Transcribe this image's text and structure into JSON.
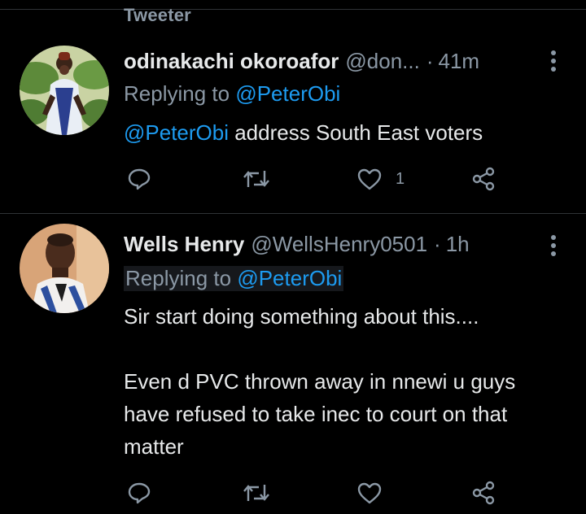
{
  "section_label": "Tweeter",
  "colors": {
    "background": "#000000",
    "text_primary": "#e7e9ea",
    "text_secondary": "#8b98a5",
    "link": "#1d9bf0",
    "divider": "#2f3336"
  },
  "tweets": [
    {
      "name": "odinakachi okoroafor",
      "handle": "@don...",
      "dot": "·",
      "time": "41m",
      "replying_prefix": "Replying to",
      "replying_handle": "@PeterObi",
      "mention": "@PeterObi",
      "body": " address South East voters",
      "like_count": "1",
      "icons": [
        "reply-icon",
        "retweet-icon",
        "like-icon",
        "share-icon",
        "more-icon"
      ]
    },
    {
      "name": "Wells Henry",
      "handle": "@WellsHenry0501",
      "dot": "·",
      "time": "1h",
      "replying_prefix": "Replying to",
      "replying_handle": "@PeterObi",
      "body_line1": "Sir start doing something about this....",
      "body_para2": "Even d PVC thrown away in nnewi u guys have refused to take inec to court on that matter",
      "like_count": "",
      "icons": [
        "reply-icon",
        "retweet-icon",
        "like-icon",
        "share-icon",
        "more-icon"
      ]
    }
  ]
}
